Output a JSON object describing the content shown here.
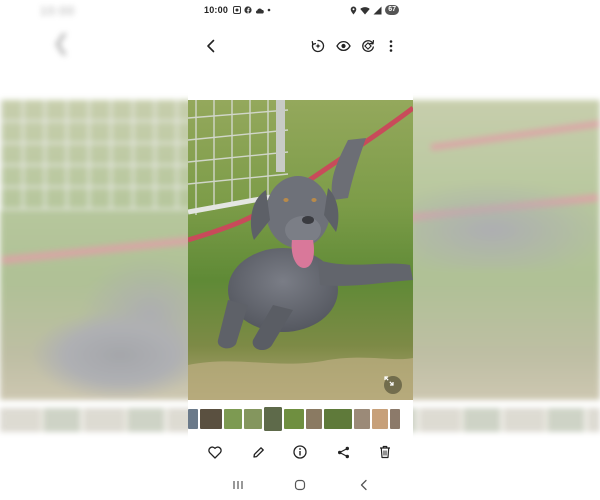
{
  "status_bar": {
    "time": "10:00",
    "battery": "67",
    "notification_icons": [
      "gallery-notif-icon",
      "facebook-icon",
      "cloud-icon",
      "dot-icon"
    ],
    "system_icons": [
      "location-icon",
      "wifi-icon",
      "signal-icon"
    ]
  },
  "top_bar": {
    "back_icon": "chevron-left-icon",
    "actions": [
      "remaster-icon",
      "eye-icon",
      "rotate-icon",
      "more-vertical-icon"
    ]
  },
  "photo": {
    "subject": "dog-photo",
    "expand_icon": "expand-icon"
  },
  "thumbnails": {
    "count": 11,
    "current_index": 4,
    "colors": [
      "#6b7a8a",
      "#5a5040",
      "#7d9a52",
      "#84965e",
      "#5e6a4a",
      "#6f8f40",
      "#8a7a62",
      "#5f7a3a",
      "#9b8a78",
      "#c7a07a",
      "#8c7a6a"
    ]
  },
  "actions": [
    "heart-icon",
    "edit-icon",
    "info-icon",
    "share-icon",
    "delete-icon"
  ],
  "system_nav": [
    "recents-icon",
    "home-icon",
    "back-icon"
  ],
  "colors": {
    "background": "#ffffff",
    "icon": "#222222",
    "battery_bg": "#555555"
  }
}
